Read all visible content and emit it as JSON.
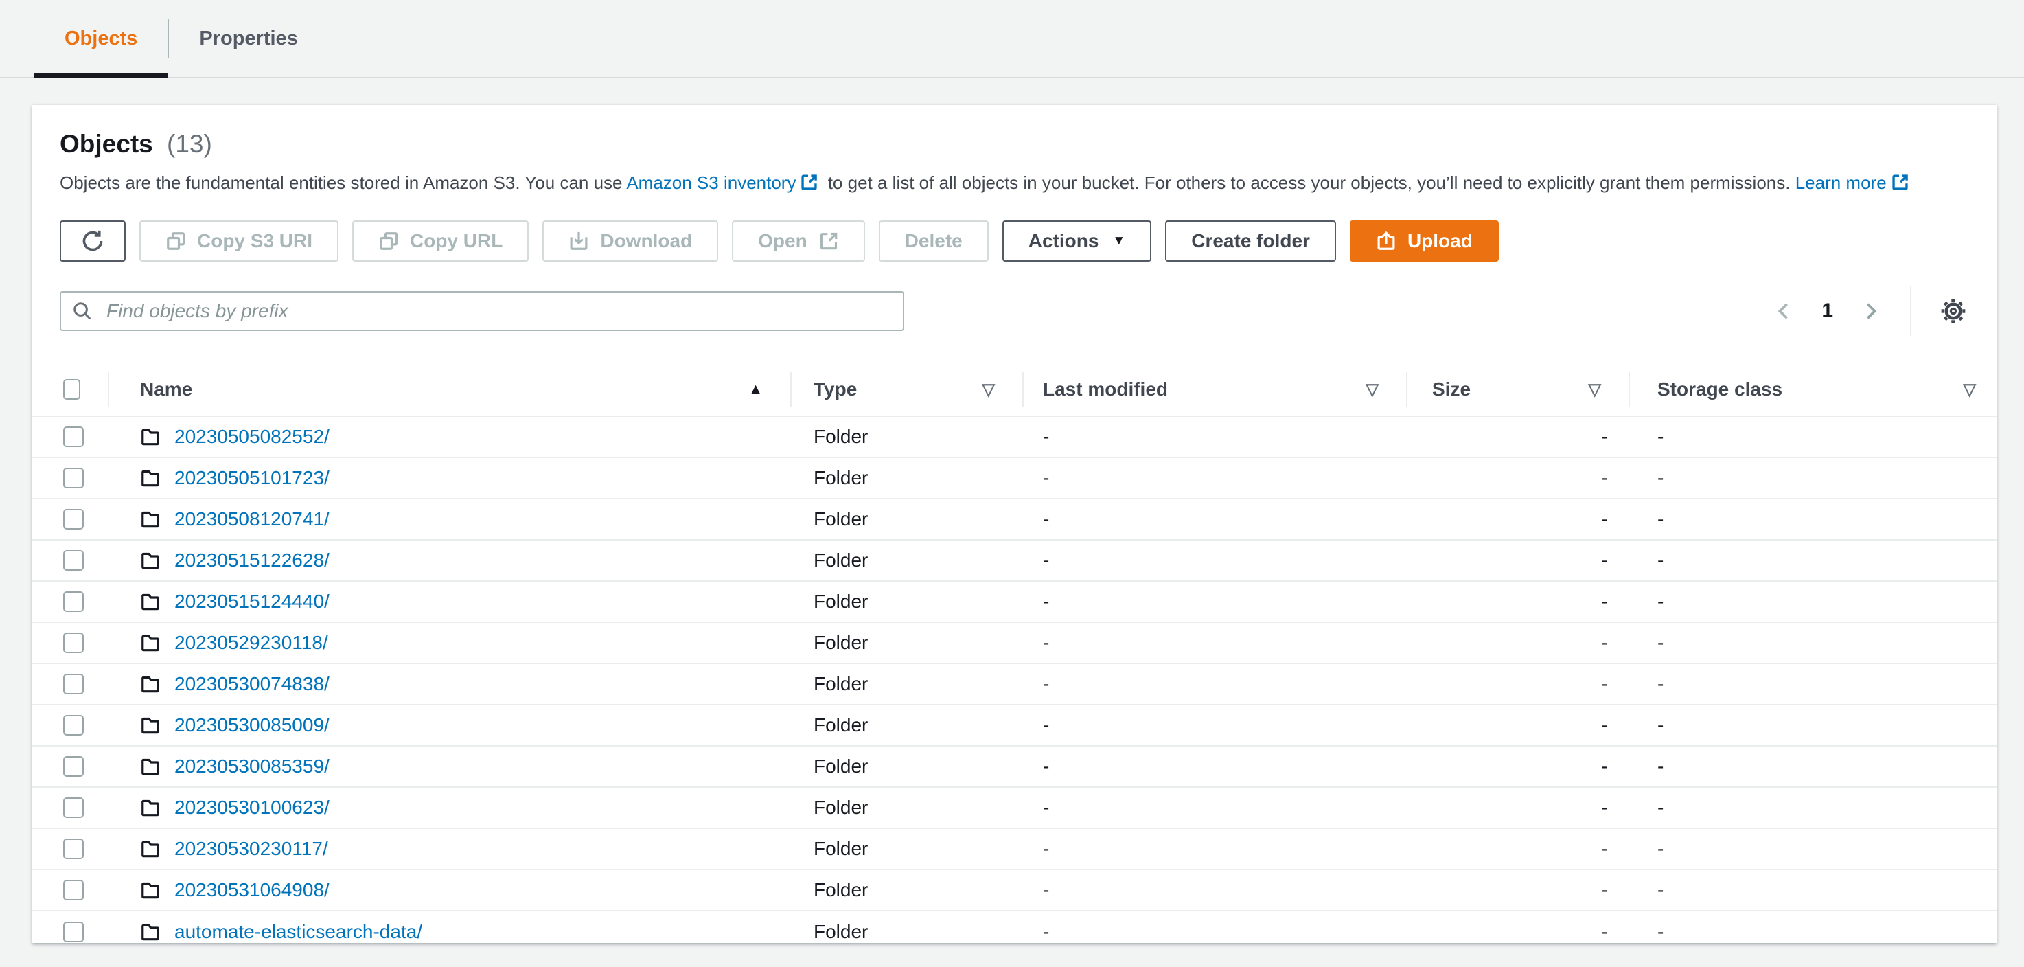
{
  "tabs": {
    "items": [
      {
        "label": "Objects",
        "active": true
      },
      {
        "label": "Properties",
        "active": false
      }
    ]
  },
  "objects_panel": {
    "title": "Objects",
    "count": "(13)",
    "description": {
      "text_before": "Objects are the fundamental entities stored in Amazon S3. You can use",
      "inventory_link": "Amazon S3 inventory",
      "text_middle": "to get a list of all objects in your bucket. For others to access your objects, you’ll need to explicitly grant them permissions.",
      "learn_more_link": "Learn more"
    },
    "toolbar": {
      "copy_s3_uri": "Copy S3 URI",
      "copy_url": "Copy URL",
      "download": "Download",
      "open": "Open",
      "delete": "Delete",
      "actions": "Actions",
      "create_folder": "Create folder",
      "upload": "Upload"
    },
    "search": {
      "placeholder": "Find objects by prefix"
    },
    "pagination": {
      "current_page": "1"
    },
    "table": {
      "columns": [
        "Name",
        "Type",
        "Last modified",
        "Size",
        "Storage class"
      ],
      "rows": [
        {
          "name": "20230505082552/",
          "type": "Folder",
          "last_modified": "-",
          "size": "-",
          "storage_class": "-"
        },
        {
          "name": "20230505101723/",
          "type": "Folder",
          "last_modified": "-",
          "size": "-",
          "storage_class": "-"
        },
        {
          "name": "20230508120741/",
          "type": "Folder",
          "last_modified": "-",
          "size": "-",
          "storage_class": "-"
        },
        {
          "name": "20230515122628/",
          "type": "Folder",
          "last_modified": "-",
          "size": "-",
          "storage_class": "-"
        },
        {
          "name": "20230515124440/",
          "type": "Folder",
          "last_modified": "-",
          "size": "-",
          "storage_class": "-"
        },
        {
          "name": "20230529230118/",
          "type": "Folder",
          "last_modified": "-",
          "size": "-",
          "storage_class": "-"
        },
        {
          "name": "20230530074838/",
          "type": "Folder",
          "last_modified": "-",
          "size": "-",
          "storage_class": "-"
        },
        {
          "name": "20230530085009/",
          "type": "Folder",
          "last_modified": "-",
          "size": "-",
          "storage_class": "-"
        },
        {
          "name": "20230530085359/",
          "type": "Folder",
          "last_modified": "-",
          "size": "-",
          "storage_class": "-"
        },
        {
          "name": "20230530100623/",
          "type": "Folder",
          "last_modified": "-",
          "size": "-",
          "storage_class": "-"
        },
        {
          "name": "20230530230117/",
          "type": "Folder",
          "last_modified": "-",
          "size": "-",
          "storage_class": "-"
        },
        {
          "name": "20230531064908/",
          "type": "Folder",
          "last_modified": "-",
          "size": "-",
          "storage_class": "-"
        },
        {
          "name": "automate-elasticsearch-data/",
          "type": "Folder",
          "last_modified": "-",
          "size": "-",
          "storage_class": "-"
        }
      ]
    }
  },
  "colors": {
    "accent_orange": "#ec7211",
    "link_blue": "#0073bb",
    "active_tab_underline": "#16191f"
  }
}
